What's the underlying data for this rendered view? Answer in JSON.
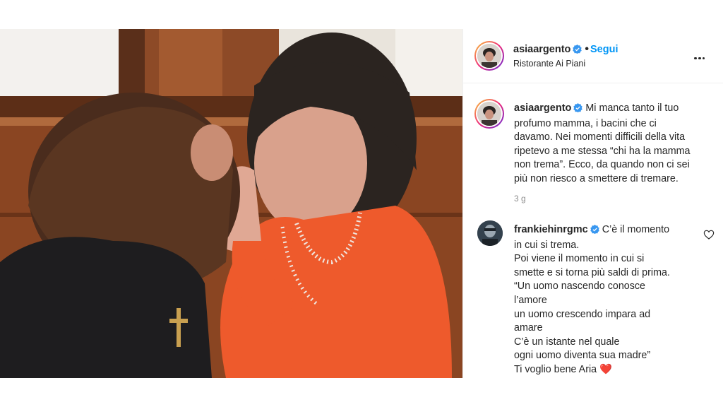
{
  "post": {
    "author": {
      "username": "asiaargento",
      "verified": true,
      "follow_label": "Segui",
      "separator": "•"
    },
    "location": "Ristorante Ai Piani",
    "caption": {
      "username": "asiaargento",
      "lines": [
        "Mi manca tanto il tuo",
        "profumo mamma, i bacini che ci",
        "davamo. Nei momenti difficili della vita",
        "ripetevo a me stessa “chi ha la mamma",
        "non trema”. Ecco, da quando non ci sei",
        "più non riesco a smettere di tremare."
      ],
      "timestamp": "3 g"
    },
    "comments": [
      {
        "username": "frankiehinrgmc",
        "verified": true,
        "lines": [
          "C’è il momento",
          "in cui si trema.",
          "Poi viene il momento in cui si",
          "smette e si torna più saldi di prima.",
          "“Un uomo nascendo conosce",
          "l’amore",
          "un uomo crescendo impara ad",
          "amare",
          "C’è un istante nel quale",
          "ogni uomo diventa sua madre”",
          "Ti voglio bene Aria ❤️"
        ]
      }
    ]
  },
  "icons": {
    "more": "more-options-icon",
    "verified": "verified-badge-icon",
    "like": "heart-icon"
  },
  "colors": {
    "link_blue": "#0095f6",
    "text": "#262626",
    "muted": "#8e8e8e",
    "verified": "#3897f0"
  }
}
